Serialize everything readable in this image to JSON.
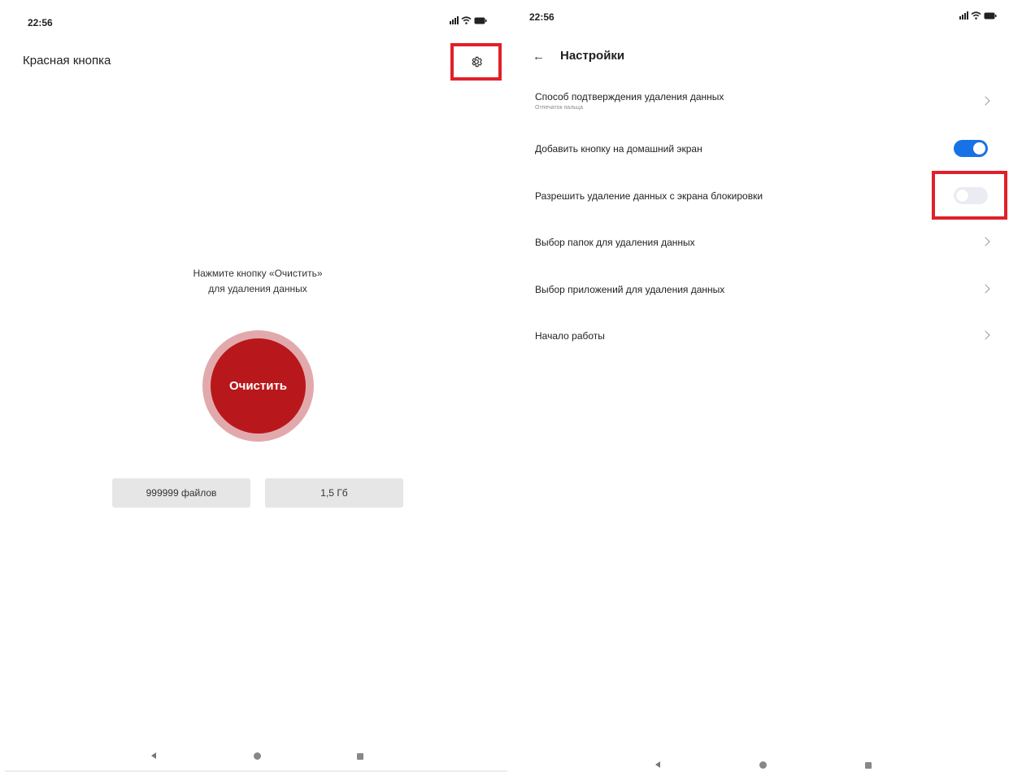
{
  "left_screen": {
    "status": {
      "time": "22:56"
    },
    "app_title": "Красная кнопка",
    "hint": {
      "line1": "Нажмите кнопку «Очистить»",
      "line2": "для удаления данных"
    },
    "clear_button_label": "Очистить",
    "stats": {
      "files": "999999 файлов",
      "size": "1,5 Гб"
    }
  },
  "right_screen": {
    "status": {
      "time": "22:56"
    },
    "title": "Настройки",
    "items": [
      {
        "label": "Способ подтверждения удаления данных",
        "sublabel": "Отпечаток пальца",
        "control": "chevron"
      },
      {
        "label": "Добавить кнопку на домашний экран",
        "control": "toggle",
        "on": true
      },
      {
        "label": "Разрешить удаление данных с экрана блокировки",
        "control": "toggle",
        "on": false
      },
      {
        "label": "Выбор папок для удаления данных",
        "control": "chevron"
      },
      {
        "label": "Выбор приложений для удаления данных",
        "control": "chevron"
      },
      {
        "label": "Начало работы",
        "control": "chevron"
      }
    ]
  },
  "icons": [
    "gear-icon",
    "back-arrow-icon",
    "chevron-right-icon",
    "signal-icon",
    "wifi-icon",
    "battery-icon",
    "nav-back-icon",
    "nav-home-icon",
    "nav-recents-icon"
  ],
  "colors": {
    "clear_button": "#b8181b",
    "clear_ring": "#e2a9ad",
    "toggle_on": "#1672e6",
    "toggle_off": "#ebebf4",
    "highlight": "#e0202a",
    "stat_background": "#e6e6e6"
  }
}
